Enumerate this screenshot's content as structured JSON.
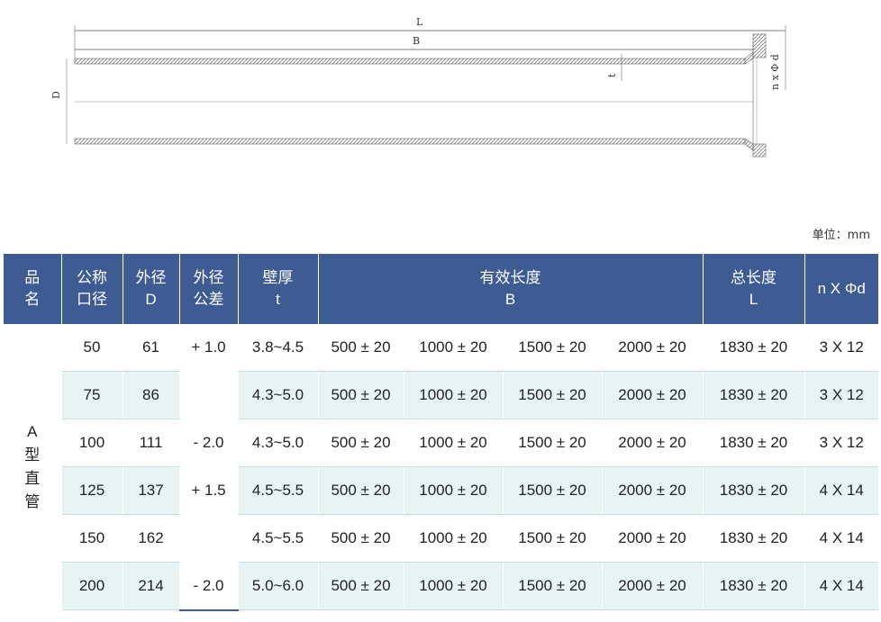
{
  "drawing": {
    "label_L": "L",
    "label_B": "B",
    "label_D": "D",
    "label_t": "t",
    "label_nd": "n x Φ d"
  },
  "unit_label": "单位：mm",
  "table": {
    "headers": {
      "name": [
        "品",
        "名"
      ],
      "dn": [
        "公称",
        "口径"
      ],
      "od": [
        "外径",
        "D"
      ],
      "tol": [
        "外径",
        "公差"
      ],
      "wall": [
        "壁厚",
        "t"
      ],
      "eff_len": [
        "有效长度",
        "B"
      ],
      "total_len": [
        "总长度",
        "L"
      ],
      "bolts": "n X Φd"
    },
    "product_name": [
      "A",
      "型",
      "直",
      "管"
    ],
    "tolerances": {
      "group1_plus": "+ 1.0",
      "group1_minus": "- 2.0",
      "group2_plus": "+ 1.5",
      "group2_minus": "- 2.0"
    },
    "rows": [
      {
        "dn": "50",
        "od": "61",
        "wall": "3.8~4.5",
        "b1": "500 ± 20",
        "b2": "1000 ± 20",
        "b3": "1500 ± 20",
        "b4": "2000 ± 20",
        "L": "1830 ± 20",
        "nd": "3 X 12"
      },
      {
        "dn": "75",
        "od": "86",
        "wall": "4.3~5.0",
        "b1": "500 ± 20",
        "b2": "1000 ± 20",
        "b3": "1500 ± 20",
        "b4": "2000 ± 20",
        "L": "1830 ± 20",
        "nd": "3 X 12"
      },
      {
        "dn": "100",
        "od": "111",
        "wall": "4.3~5.0",
        "b1": "500 ± 20",
        "b2": "1000 ± 20",
        "b3": "1500 ± 20",
        "b4": "2000 ± 20",
        "L": "1830 ± 20",
        "nd": "3 X 12"
      },
      {
        "dn": "125",
        "od": "137",
        "wall": "4.5~5.5",
        "b1": "500 ± 20",
        "b2": "1000 ± 20",
        "b3": "1500 ± 20",
        "b4": "2000 ± 20",
        "L": "1830 ± 20",
        "nd": "4 X 14"
      },
      {
        "dn": "150",
        "od": "162",
        "wall": "4.5~5.5",
        "b1": "500 ± 20",
        "b2": "1000 ± 20",
        "b3": "1500 ± 20",
        "b4": "2000 ± 20",
        "L": "1830 ± 20",
        "nd": "4 X 14"
      },
      {
        "dn": "200",
        "od": "214",
        "wall": "5.0~6.0",
        "b1": "500 ± 20",
        "b2": "1000 ± 20",
        "b3": "1500 ± 20",
        "b4": "2000 ± 20",
        "L": "1830 ± 20",
        "nd": "4 X 14"
      }
    ]
  },
  "colors": {
    "header_bg": "#3e5b94",
    "stripe_bg": "#e8f4f4"
  }
}
